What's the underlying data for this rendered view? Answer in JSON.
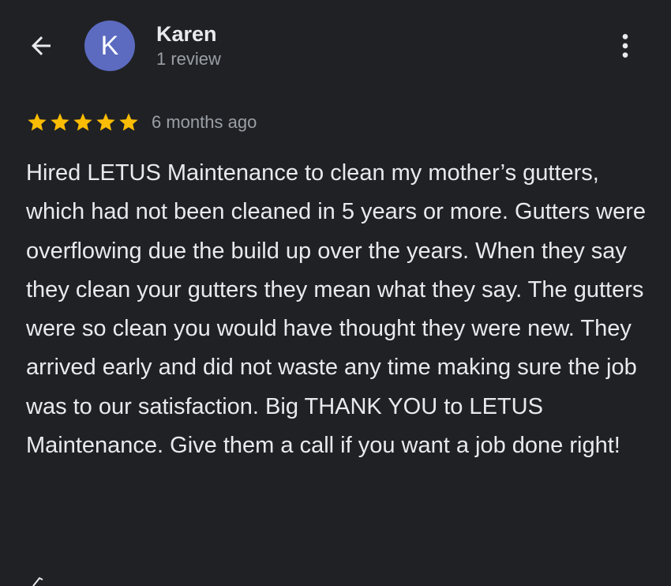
{
  "header": {
    "back_icon": "arrow-back-icon",
    "avatar_letter": "K",
    "avatar_color": "#5c6bc0",
    "reviewer_name": "Karen",
    "review_count": "1 review",
    "menu_icon": "more-vert-icon"
  },
  "review": {
    "rating": 5,
    "max_rating": 5,
    "star_color": "#fbbc04",
    "time_ago": "6 months ago",
    "text": "Hired LETUS Maintenance to clean my mother’s gutters, which had not been cleaned in 5 years or more. Gutters were overflowing due the build up over the years. When they say they clean your gutters they mean what they say. The gutters were so clean you would have thought they were new. They arrived early and did not waste any time making sure the job was to our satisfaction. Big THANK YOU to LETUS Maintenance. Give them a call if you want a job done right!"
  },
  "colors": {
    "background": "#202124",
    "primary_text": "#e8eaed",
    "secondary_text": "#9aa0a6"
  }
}
